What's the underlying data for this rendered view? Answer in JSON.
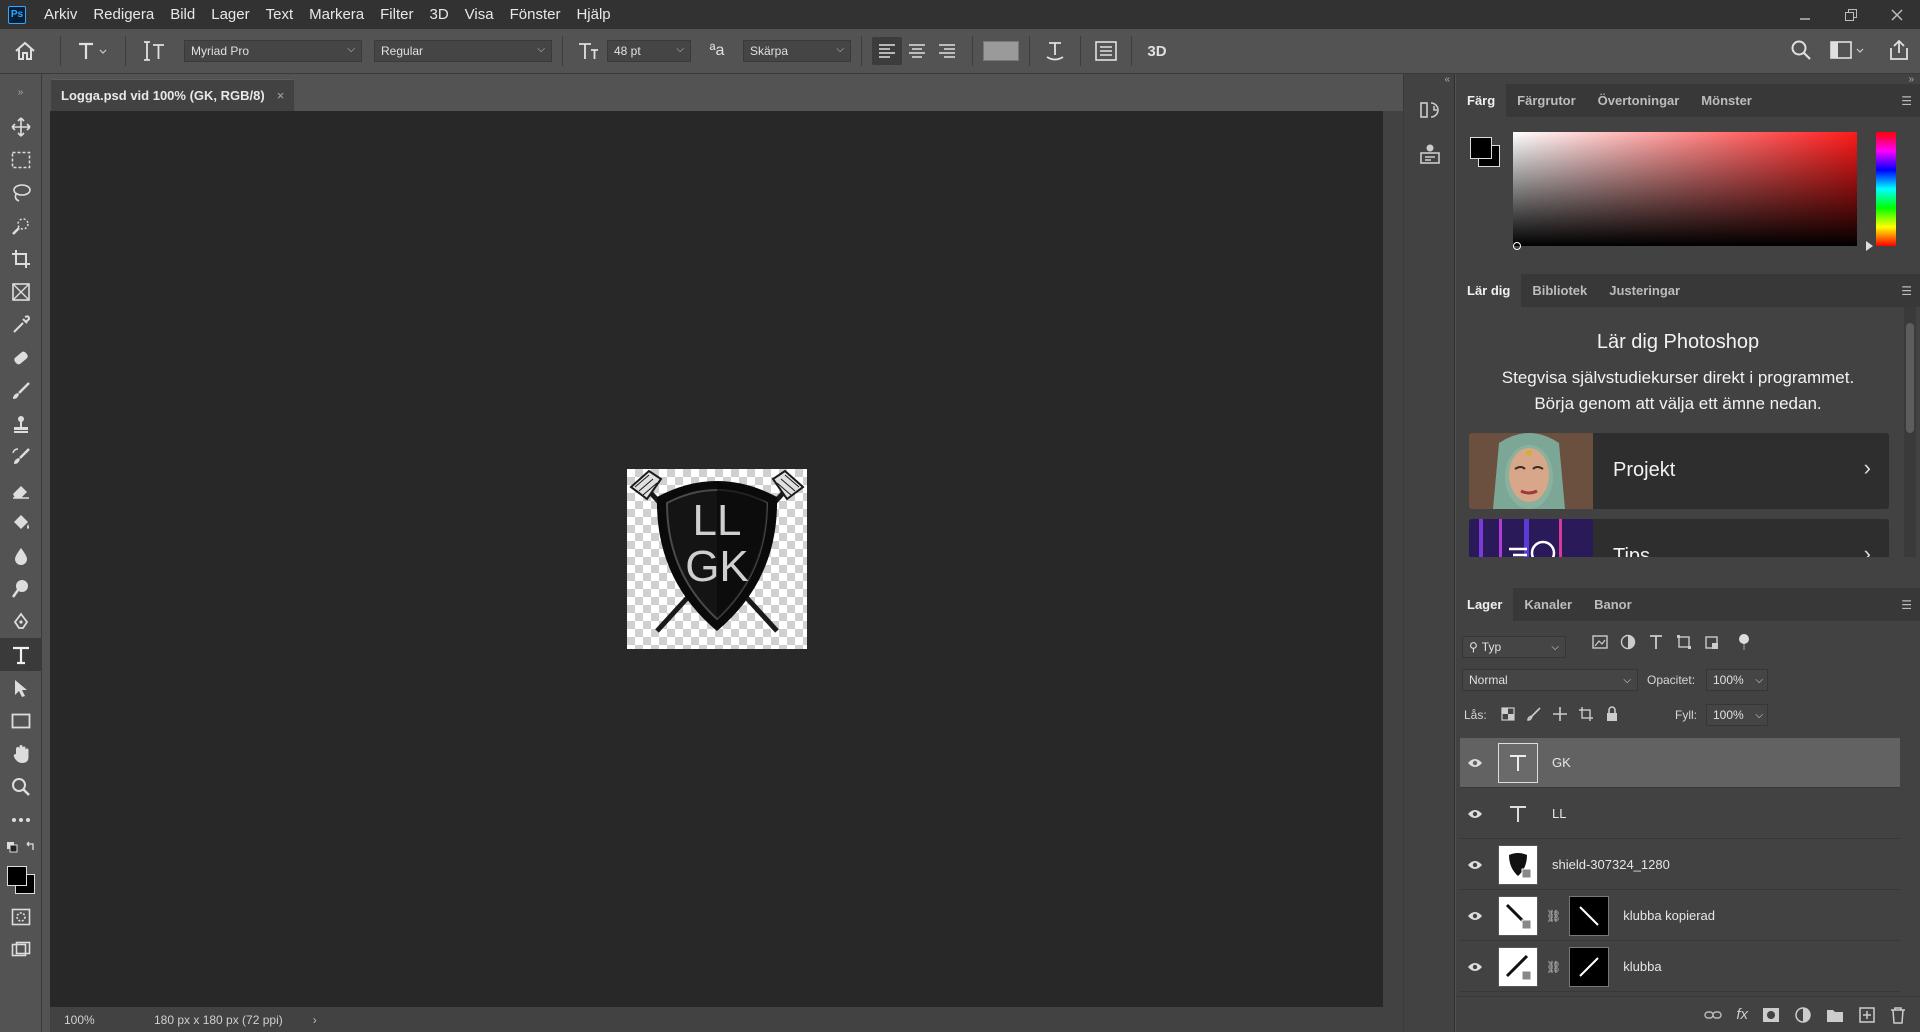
{
  "menubar": {
    "app_logo": "Ps",
    "items": [
      "Arkiv",
      "Redigera",
      "Bild",
      "Lager",
      "Text",
      "Markera",
      "Filter",
      "3D",
      "Visa",
      "Fönster",
      "Hjälp"
    ],
    "window_controls": [
      "minimize-icon",
      "restore-icon",
      "close-icon"
    ]
  },
  "options": {
    "font_family": "Myriad Pro",
    "font_style": "Regular",
    "font_size": "48 pt",
    "aa_label": "ªa",
    "antialias": "Skärpa",
    "threed_label": "3D",
    "text_color": "#9a9a9a"
  },
  "document": {
    "tab_title": "Logga.psd vid 100% (GK, RGB/8)",
    "zoom": "100%",
    "doc_info": "180 px x 180 px (72 ppi)",
    "artwork_line1": "LL",
    "artwork_line2": "GK"
  },
  "color_panel": {
    "tabs": [
      "Färg",
      "Färgrutor",
      "Övertoningar",
      "Mönster"
    ],
    "active_tab": "Färg",
    "hue_color": "#ff1a1a",
    "foreground": "#000000",
    "background": "#000000"
  },
  "learn_panel": {
    "tabs": [
      "Lär dig",
      "Bibliotek",
      "Justeringar"
    ],
    "title": "Lär dig Photoshop",
    "subtitle": "Stegvisa självstudiekurser direkt i programmet. Börja genom att välja ett ämne nedan.",
    "cards": [
      "Projekt",
      "Tips"
    ]
  },
  "layers_panel": {
    "tabs": [
      "Lager",
      "Kanaler",
      "Banor"
    ],
    "filter_label": "Typ",
    "blend_mode": "Normal",
    "opacity_label": "Opacitet:",
    "opacity_value": "100%",
    "lock_label": "Lås:",
    "fill_label": "Fyll:",
    "fill_value": "100%",
    "layers": [
      {
        "name": "GK",
        "kind": "text",
        "selected": true
      },
      {
        "name": "LL",
        "kind": "text",
        "selected": false
      },
      {
        "name": "shield-307324_1280",
        "kind": "smart",
        "selected": false
      },
      {
        "name": "klubba kopierad",
        "kind": "smart-mask",
        "selected": false
      },
      {
        "name": "klubba",
        "kind": "smart-mask",
        "selected": false
      }
    ],
    "footer_fx": "fx"
  }
}
